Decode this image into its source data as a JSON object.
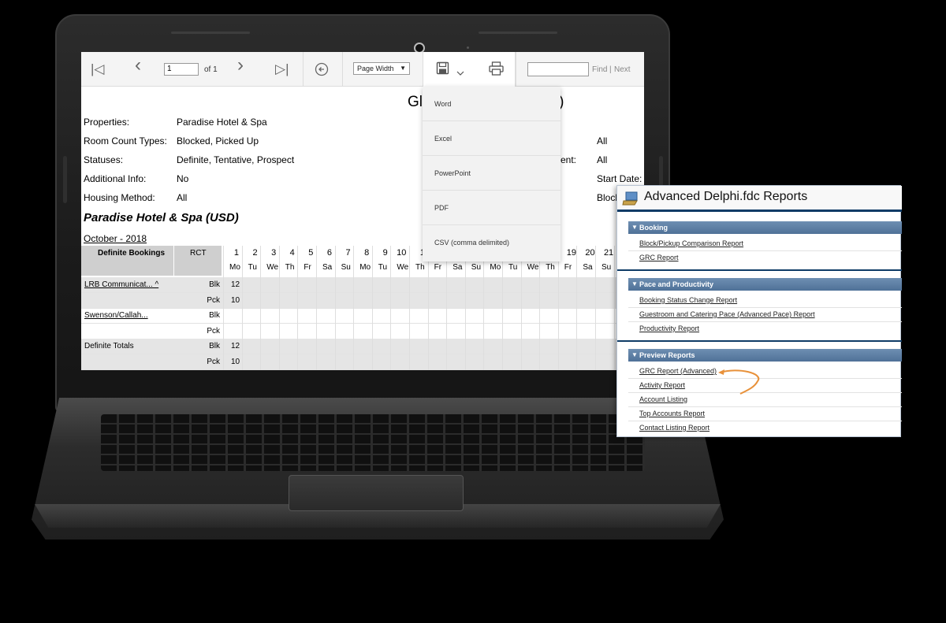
{
  "toolbar": {
    "first_icon": "|◁",
    "prev_icon": "‹",
    "page_value": "1",
    "page_of": "of 1",
    "next_icon": "›",
    "last_icon": "▷|",
    "back_icon": "⊖",
    "zoom_value": "Page Width",
    "zoom_arrow": "▼",
    "save_icon": "floppy-disk",
    "print_icon": "printer",
    "find_label": "Find",
    "next_label": "Next"
  },
  "export_menu": {
    "items": [
      "Word",
      "Excel",
      "PowerPoint",
      "PDF",
      "CSV (comma delimited)"
    ]
  },
  "report": {
    "title_left": "Gl",
    "title_right": "ed)",
    "params": [
      {
        "label": "Properties:",
        "value": "Paradise Hotel & Spa"
      },
      {
        "label": "Room Count Types:",
        "value": "Blocked, Picked Up"
      },
      {
        "label": "Statuses:",
        "value": "Definite, Tentative, Prospect"
      },
      {
        "label": "Additional Info:",
        "value": "No"
      },
      {
        "label": "Housing Method:",
        "value": "All"
      }
    ],
    "right_params": {
      "all_1": "All",
      "ent_label": "ent:",
      "all_2": "All",
      "start_date": "Start Date:",
      "block": "Block"
    },
    "hotel_heading": "Paradise Hotel & Spa (USD)",
    "month_heading": "October - 2018",
    "grid": {
      "header_bookings": "Definite Bookings",
      "header_rct": "RCT",
      "days": [
        "1",
        "2",
        "3",
        "4",
        "5",
        "6",
        "7",
        "8",
        "9",
        "10",
        "1"
      ],
      "days_right": [
        "19",
        "20",
        "21"
      ],
      "day_names": [
        "Mo",
        "Tu",
        "We",
        "Th",
        "Fr",
        "Sa",
        "Su",
        "Mo",
        "Tu",
        "We",
        "Th",
        "Fr",
        "Sa",
        "Su",
        "Mo",
        "Tu",
        "We",
        "Th",
        "Fr",
        "Sa",
        "Su"
      ],
      "rows": [
        {
          "name": "LRB Communicat... ^",
          "rct": "Blk",
          "value": "12"
        },
        {
          "name": "",
          "rct": "Pck",
          "value": "10"
        },
        {
          "name": "Swenson/Callah...",
          "rct": "Blk",
          "value": ""
        },
        {
          "name": "",
          "rct": "Pck",
          "value": ""
        },
        {
          "name": "Definite Totals",
          "rct": "Blk",
          "value": "12"
        },
        {
          "name": "",
          "rct": "Pck",
          "value": "10"
        }
      ]
    }
  },
  "panel": {
    "title": "Advanced Delphi.fdc Reports",
    "sections": [
      {
        "name": "Booking",
        "links": [
          "Block/Pickup Comparison Report",
          "GRC Report"
        ]
      },
      {
        "name": "Pace and Productivity",
        "links": [
          "Booking Status Change Report",
          "Guestroom and Catering Pace (Advanced Pace) Report",
          "Productivity Report"
        ]
      },
      {
        "name": "Preview Reports",
        "links": [
          "GRC Report (Advanced)",
          "Activity Report",
          "Account Listing",
          "Top Accounts Report",
          "Contact Listing Report"
        ]
      }
    ]
  },
  "colors": {
    "section_bar": "#5a7ca3",
    "panel_rule": "#0e3b66",
    "arrow": "#e8913a",
    "grid_header": "#cfcfcf"
  }
}
